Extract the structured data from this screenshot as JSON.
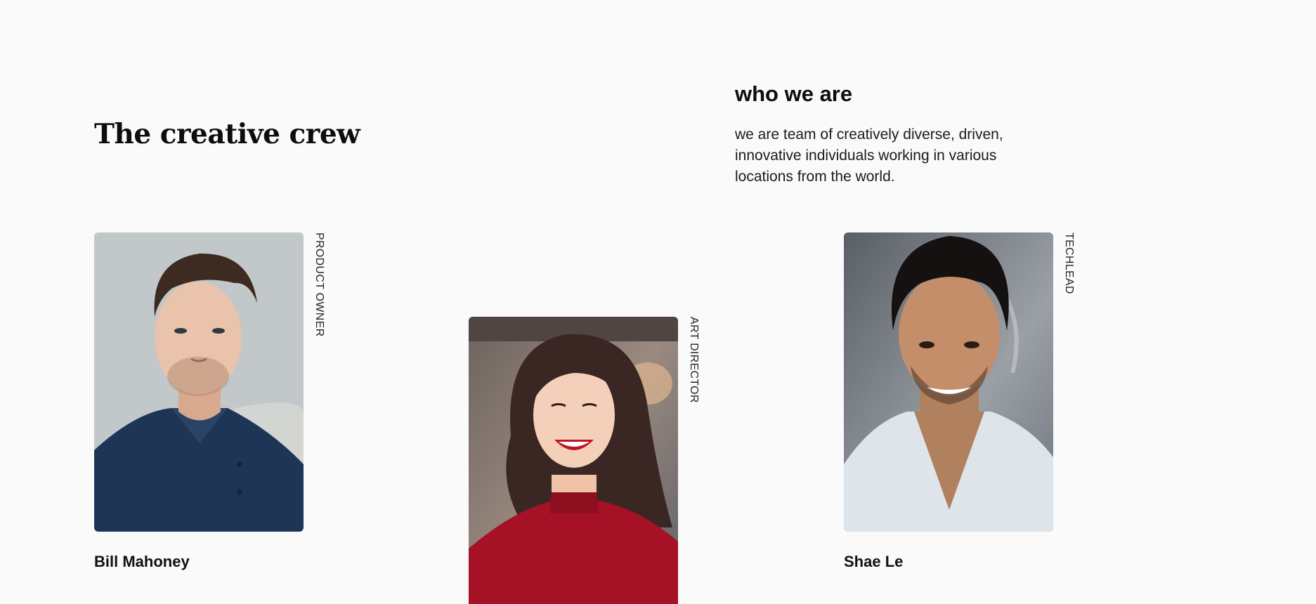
{
  "section": {
    "title": "The creative crew"
  },
  "about": {
    "heading": "who we are",
    "text": "we are team of creatively diverse, driven, innovative individuals working in various locations from the world."
  },
  "team": [
    {
      "name": "Bill Mahoney",
      "role": "PRODUCT OWNER",
      "photo_icon": "portrait-photo"
    },
    {
      "name": "",
      "role": "ART DIRECTOR",
      "photo_icon": "portrait-photo"
    },
    {
      "name": "Shae Le",
      "role": "TECHLEAD",
      "photo_icon": "portrait-photo"
    }
  ],
  "colors": {
    "background": "#fafafa",
    "text": "#111111"
  }
}
